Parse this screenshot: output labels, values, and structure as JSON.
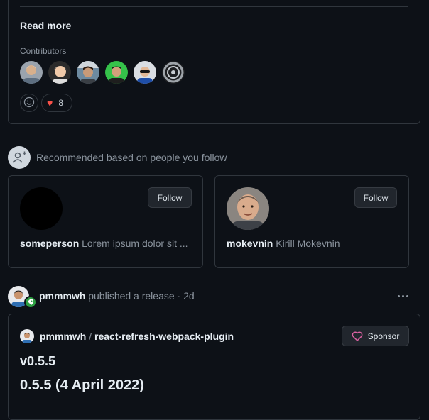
{
  "top_card": {
    "read_more": "Read more",
    "contributors_label": "Contributors",
    "reaction_count": "8",
    "heart": "♥"
  },
  "recommended": {
    "heading": "Recommended based on people you follow",
    "cards": [
      {
        "username": "someperson",
        "bio": "Lorem ipsum dolor sit ...",
        "follow_label": "Follow"
      },
      {
        "username": "mokevnin",
        "bio": "Kirill Mokevnin",
        "follow_label": "Follow"
      }
    ]
  },
  "release": {
    "actor": "pmmmwh",
    "action": "published a release",
    "separator": "·",
    "age": "2d",
    "repo_owner": "pmmmwh",
    "repo_slash": "/",
    "repo_name": "react-refresh-webpack-plugin",
    "sponsor_label": "Sponsor",
    "version": "v0.5.5",
    "release_title": "0.5.5 (4 April 2022)"
  },
  "colors": {
    "background": "#0d1117",
    "border": "#30363d",
    "heart_red": "#f85149",
    "sponsor_pink": "#db61a2",
    "release_badge_green": "#2ea043"
  }
}
